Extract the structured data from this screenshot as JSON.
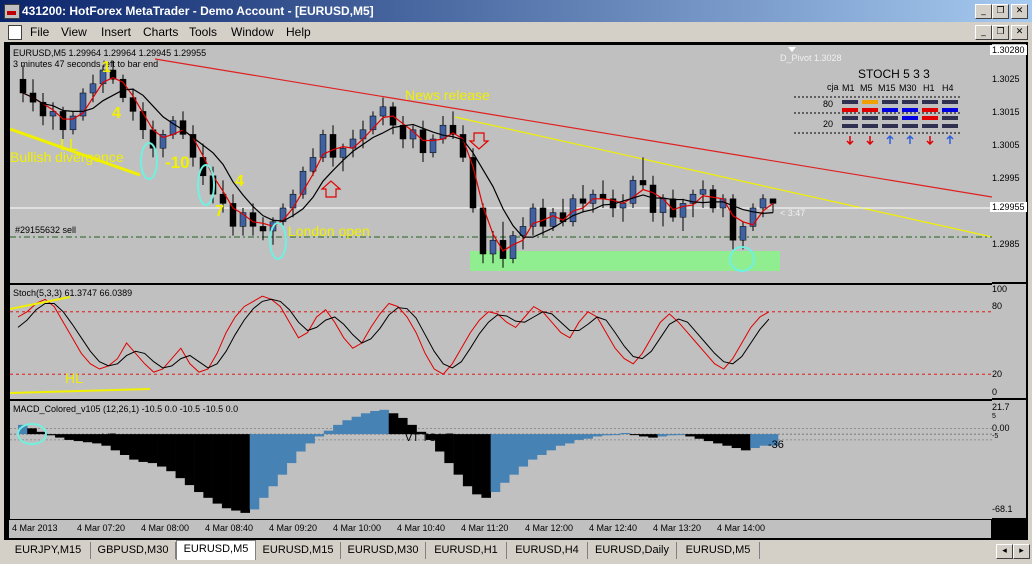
{
  "window": {
    "title": "431200: HotForex MetaTrader - Demo Account - [EURUSD,M5]",
    "min": "_",
    "restore": "❐",
    "close": "✕"
  },
  "menu": [
    "File",
    "View",
    "Insert",
    "Charts",
    "Tools",
    "Window",
    "Help"
  ],
  "chart": {
    "symbol_info": "EURUSD,M5  1.29964 1.29964 1.29945 1.29955",
    "bar_timer": "3 minutes 47 seconds left to bar end",
    "pivot_label": "D_Pivot 1.3028",
    "pivot_value": "1.30280",
    "current_price": "1.29955",
    "countdown": "< 3:47",
    "order_label": "#29155632 sell",
    "price_ticks": [
      "1.3025",
      "1.3015",
      "1.3005",
      "1.2995",
      "1.2985"
    ],
    "annotations": {
      "news": "News release",
      "london": "London open",
      "ll": "LL",
      "bullish": "Bullish divergence",
      "n4a": "4",
      "n10": "-10",
      "n4b": "4",
      "n7": "7",
      "n1": "1"
    },
    "stoch_table": {
      "title": "STOCH  5 3 3",
      "cja": "cja",
      "timeframes": [
        "M1",
        "M5",
        "M15",
        "M30",
        "H1",
        "H4"
      ],
      "levels": [
        "80",
        "20"
      ],
      "arrows": [
        "down",
        "down",
        "up",
        "up",
        "down",
        "up"
      ]
    }
  },
  "stoch_panel": {
    "label": "Stoch(5,3,3) 61.3747 66.0389",
    "hl": "HL",
    "ticks": [
      "100",
      "80",
      "20",
      "0"
    ]
  },
  "macd_panel": {
    "label": "MACD_Colored_v105 (12,26,1) -10.5 0.0 -10.5 -10.5 0.0",
    "vt1": "VT",
    "vt2": "VT  TC VT",
    "value_tag": "-36",
    "ticks": [
      "21.7",
      "0.00",
      "-68.1"
    ],
    "small_ticks": [
      "5",
      "0.00",
      "-5"
    ]
  },
  "time_axis": [
    "4 Mar 2013",
    "4 Mar 07:20",
    "4 Mar 08:00",
    "4 Mar 08:40",
    "4 Mar 09:20",
    "4 Mar 10:00",
    "4 Mar 10:40",
    "4 Mar 11:20",
    "4 Mar 12:00",
    "4 Mar 12:40",
    "4 Mar 13:20",
    "4 Mar 14:00"
  ],
  "tabs": [
    "EURJPY,M15",
    "GBPUSD,M30",
    "EURUSD,M5",
    "EURUSD,M15",
    "EURUSD,M30",
    "EURUSD,H1",
    "EURUSD,H4",
    "EURUSD,Daily",
    "EURUSD,M5"
  ],
  "active_tab": 2,
  "colors": {
    "bull": "#4060a0",
    "bear": "#000000",
    "fast_ma": "#e00000",
    "slow_ma": "#000000",
    "trend_red": "#e02020",
    "trend_yellow": "#f0f000",
    "zone": "#90ee90",
    "ellipse": "#70f0e0",
    "macd_pos": "#4682b4",
    "macd_neg": "#000000"
  },
  "chart_data": {
    "type": "candlestick",
    "price_range": [
      1.298,
      1.303
    ],
    "candles": [
      [
        1.3023,
        1.3026,
        1.3018,
        1.302
      ],
      [
        1.302,
        1.3023,
        1.3016,
        1.3018
      ],
      [
        1.3018,
        1.302,
        1.3013,
        1.3015
      ],
      [
        1.3015,
        1.3018,
        1.3012,
        1.3016
      ],
      [
        1.3016,
        1.3017,
        1.301,
        1.3012
      ],
      [
        1.3012,
        1.3016,
        1.3011,
        1.3015
      ],
      [
        1.3015,
        1.3021,
        1.3014,
        1.302
      ],
      [
        1.302,
        1.3024,
        1.3018,
        1.3022
      ],
      [
        1.3022,
        1.3026,
        1.302,
        1.3025
      ],
      [
        1.3025,
        1.3027,
        1.3022,
        1.3023
      ],
      [
        1.3023,
        1.3024,
        1.3018,
        1.3019
      ],
      [
        1.3019,
        1.3021,
        1.3014,
        1.3016
      ],
      [
        1.3016,
        1.3018,
        1.301,
        1.3012
      ],
      [
        1.3012,
        1.3014,
        1.3006,
        1.3008
      ],
      [
        1.3008,
        1.3012,
        1.3006,
        1.3011
      ],
      [
        1.3011,
        1.3015,
        1.301,
        1.3014
      ],
      [
        1.3014,
        1.3016,
        1.301,
        1.3011
      ],
      [
        1.3011,
        1.3013,
        1.3004,
        1.3006
      ],
      [
        1.3006,
        1.3009,
        1.3,
        1.3002
      ],
      [
        1.3002,
        1.3004,
        1.2996,
        1.2998
      ],
      [
        1.2998,
        1.3001,
        1.2994,
        1.2996
      ],
      [
        1.2996,
        1.2998,
        1.2989,
        1.2991
      ],
      [
        1.2991,
        1.2995,
        1.2989,
        1.2994
      ],
      [
        1.2994,
        1.2996,
        1.2989,
        1.2991
      ],
      [
        1.2991,
        1.2993,
        1.2988,
        1.299
      ],
      [
        1.299,
        1.2993,
        1.2987,
        1.2992
      ],
      [
        1.2992,
        1.2996,
        1.2991,
        1.2995
      ],
      [
        1.2995,
        1.2999,
        1.2993,
        1.2998
      ],
      [
        1.2998,
        1.3004,
        1.2997,
        1.3003
      ],
      [
        1.3003,
        1.3008,
        1.3002,
        1.3006
      ],
      [
        1.3006,
        1.3012,
        1.3005,
        1.3011
      ],
      [
        1.3011,
        1.3013,
        1.3004,
        1.3006
      ],
      [
        1.3006,
        1.3009,
        1.3003,
        1.3008
      ],
      [
        1.3008,
        1.3012,
        1.3006,
        1.301
      ],
      [
        1.301,
        1.3014,
        1.3008,
        1.3012
      ],
      [
        1.3012,
        1.3016,
        1.3011,
        1.3015
      ],
      [
        1.3015,
        1.3019,
        1.3013,
        1.3017
      ],
      [
        1.3017,
        1.3018,
        1.3011,
        1.3013
      ],
      [
        1.3013,
        1.3015,
        1.3008,
        1.301
      ],
      [
        1.301,
        1.3013,
        1.3008,
        1.3012
      ],
      [
        1.3012,
        1.3014,
        1.3005,
        1.3007
      ],
      [
        1.3007,
        1.3011,
        1.3006,
        1.301
      ],
      [
        1.301,
        1.3015,
        1.3009,
        1.3013
      ],
      [
        1.3013,
        1.3016,
        1.301,
        1.3011
      ],
      [
        1.3011,
        1.3013,
        1.3005,
        1.3006
      ],
      [
        1.3006,
        1.3008,
        1.2994,
        1.2995
      ],
      [
        1.2995,
        1.2996,
        1.2983,
        1.2985
      ],
      [
        1.2985,
        1.299,
        1.2983,
        1.2988
      ],
      [
        1.2988,
        1.2992,
        1.2982,
        1.2984
      ],
      [
        1.2984,
        1.299,
        1.2983,
        1.2989
      ],
      [
        1.2989,
        1.2993,
        1.2986,
        1.2991
      ],
      [
        1.2991,
        1.2996,
        1.2989,
        1.2995
      ],
      [
        1.2995,
        1.2997,
        1.2989,
        1.2991
      ],
      [
        1.2991,
        1.2995,
        1.299,
        1.2994
      ],
      [
        1.2994,
        1.2997,
        1.2991,
        1.2992
      ],
      [
        1.2992,
        1.2998,
        1.2991,
        1.2997
      ],
      [
        1.2997,
        1.3,
        1.2994,
        1.2996
      ],
      [
        1.2996,
        1.2999,
        1.2994,
        1.2998
      ],
      [
        1.2998,
        1.3001,
        1.2995,
        1.2997
      ],
      [
        1.2997,
        1.2999,
        1.2993,
        1.2995
      ],
      [
        1.2995,
        1.2998,
        1.2992,
        1.2996
      ],
      [
        1.2996,
        1.3002,
        1.2995,
        1.3001
      ],
      [
        1.3001,
        1.3006,
        1.2999,
        1.3
      ],
      [
        1.3,
        1.3002,
        1.2992,
        1.2994
      ],
      [
        1.2994,
        1.2998,
        1.2991,
        1.2997
      ],
      [
        1.2997,
        1.2999,
        1.2992,
        1.2993
      ],
      [
        1.2993,
        1.2997,
        1.299,
        1.2996
      ],
      [
        1.2996,
        1.2999,
        1.2993,
        1.2998
      ],
      [
        1.2998,
        1.3001,
        1.2995,
        1.2999
      ],
      [
        1.2999,
        1.3,
        1.2994,
        1.2995
      ],
      [
        1.2995,
        1.2998,
        1.2993,
        1.2997
      ],
      [
        1.2997,
        1.2998,
        1.2986,
        1.2988
      ],
      [
        1.2988,
        1.2992,
        1.2986,
        1.2991
      ],
      [
        1.2991,
        1.2996,
        1.299,
        1.2995
      ],
      [
        1.2995,
        1.2998,
        1.2993,
        1.2997
      ],
      [
        1.2997,
        1.2997,
        1.2994,
        1.2996
      ]
    ],
    "stoch_k": [
      75,
      80,
      88,
      92,
      85,
      70,
      55,
      40,
      30,
      25,
      28,
      35,
      50,
      40,
      30,
      22,
      25,
      35,
      45,
      30,
      22,
      25,
      40,
      60,
      75,
      85,
      90,
      95,
      92,
      85,
      70,
      55,
      60,
      75,
      82,
      70,
      55,
      45,
      50,
      65,
      78,
      88,
      85,
      75,
      60,
      40,
      25,
      20,
      30,
      45,
      60,
      72,
      80,
      78,
      70,
      65,
      75,
      85,
      80,
      70,
      60,
      55,
      70,
      80,
      75,
      60,
      45,
      35,
      30,
      40,
      55,
      70,
      78,
      70,
      60,
      50,
      40,
      30,
      25,
      35,
      50,
      65,
      75,
      80
    ],
    "stoch_d": [
      65,
      72,
      82,
      88,
      88,
      80,
      68,
      55,
      42,
      32,
      28,
      30,
      38,
      42,
      40,
      32,
      26,
      28,
      35,
      38,
      32,
      26,
      30,
      42,
      58,
      72,
      83,
      90,
      92,
      90,
      82,
      70,
      62,
      65,
      72,
      75,
      68,
      58,
      50,
      54,
      64,
      77,
      84,
      83,
      74,
      58,
      42,
      30,
      26,
      32,
      45,
      59,
      70,
      77,
      76,
      71,
      70,
      75,
      80,
      78,
      70,
      62,
      62,
      68,
      75,
      72,
      60,
      47,
      37,
      35,
      42,
      55,
      68,
      73,
      70,
      60,
      50,
      40,
      32,
      30,
      37,
      50,
      63,
      73
    ],
    "macd": [
      8,
      5,
      2,
      -1,
      -3,
      -5,
      -6,
      -7,
      -8,
      -10,
      -14,
      -18,
      -22,
      -24,
      -25,
      -28,
      -32,
      -38,
      -44,
      -50,
      -55,
      -60,
      -64,
      -66,
      -68,
      -65,
      -55,
      -45,
      -35,
      -25,
      -15,
      -8,
      -2,
      3,
      8,
      12,
      15,
      18,
      20,
      21,
      18,
      14,
      8,
      2,
      -5,
      -15,
      -25,
      -35,
      -45,
      -52,
      -55,
      -50,
      -42,
      -35,
      -28,
      -22,
      -18,
      -14,
      -10,
      -8,
      -5,
      -4,
      -2,
      -1,
      0,
      1,
      0,
      -2,
      -3,
      -2,
      -1,
      0,
      -2,
      -4,
      -6,
      -8,
      -10,
      -12,
      -14,
      -12,
      -10,
      -10
    ],
    "macd_range": [
      -68.1,
      21.7
    ]
  }
}
